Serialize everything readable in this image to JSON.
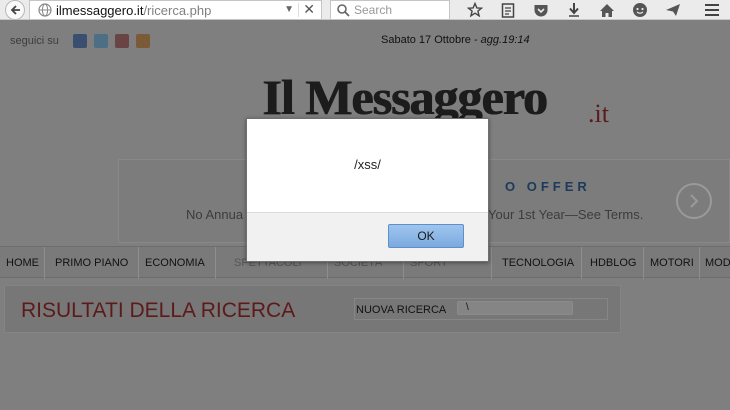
{
  "browser": {
    "url_host": "ilmessaggero.it",
    "url_path": "/ricerca.php",
    "search_placeholder": "Search",
    "icons": [
      "back-icon",
      "globe-icon",
      "dropdown-icon",
      "clear-icon",
      "search-icon",
      "bookmark-star-icon",
      "reading-list-icon",
      "pocket-icon",
      "download-icon",
      "home-icon",
      "chat-icon",
      "send-icon",
      "menu-icon"
    ]
  },
  "site": {
    "follow_label": "seguici su",
    "social": [
      {
        "name": "facebook",
        "color": "#3b5998"
      },
      {
        "name": "twitter",
        "color": "#55acee"
      },
      {
        "name": "googleplus",
        "color": "#dd4b39"
      },
      {
        "name": "rss",
        "color": "#f26522"
      }
    ],
    "date": "Sabato 17 Ottobre - ",
    "updated": "agg.19:14",
    "logo": "Il Messaggero",
    "logo_suffix": ".it"
  },
  "banner": {
    "offer": "O OFFER",
    "text_left": "No Annua",
    "text_right": "Your 1st Year—See Terms."
  },
  "nav": [
    "HOME",
    "PRIMO PIANO",
    "ECONOMIA",
    "SPETTACOLI",
    "SOCIETÀ",
    "SPORT",
    "TECNOLOGIA",
    "HDBLOG",
    "MOTORI",
    "MOD"
  ],
  "results": {
    "title": "RISULTATI DELLA RICERCA",
    "new_search_label": "NUOVA RICERCA",
    "search_value": "\\"
  },
  "dialog": {
    "message": "/xss/",
    "ok_label": "OK"
  },
  "colors": {
    "accent_blue": "#7baae0",
    "logo_red": "#a2231d"
  }
}
